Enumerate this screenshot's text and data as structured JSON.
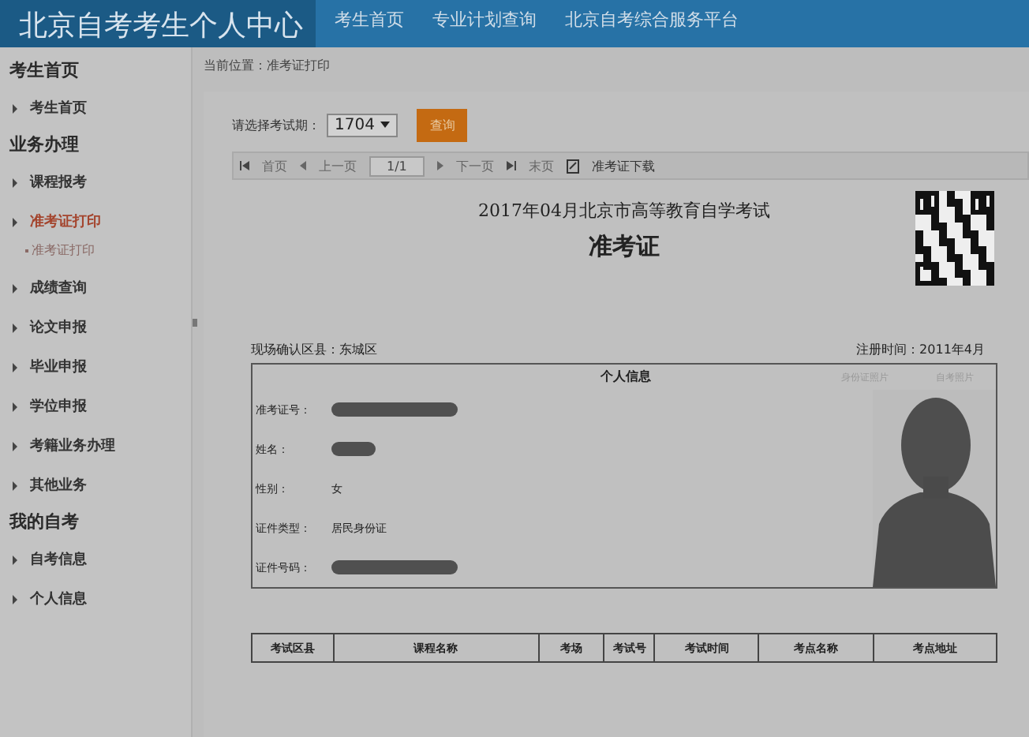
{
  "header": {
    "title": "北京自考考生个人中心",
    "nav": [
      "考生首页",
      "专业计划查询",
      "北京自考综合服务平台"
    ]
  },
  "sidebar": [
    {
      "kind": "heading",
      "label": "考生首页"
    },
    {
      "kind": "item",
      "label": "考生首页",
      "selected": false
    },
    {
      "kind": "heading",
      "label": "业务办理"
    },
    {
      "kind": "item",
      "label": "课程报考",
      "selected": false
    },
    {
      "kind": "item",
      "label": "准考证打印",
      "selected": true,
      "children": [
        {
          "label": "准考证打印"
        }
      ]
    },
    {
      "kind": "item",
      "label": "成绩查询",
      "selected": false
    },
    {
      "kind": "item",
      "label": "论文申报",
      "selected": false
    },
    {
      "kind": "item",
      "label": "毕业申报",
      "selected": false
    },
    {
      "kind": "item",
      "label": "学位申报",
      "selected": false
    },
    {
      "kind": "item",
      "label": "考籍业务办理",
      "selected": false
    },
    {
      "kind": "item",
      "label": "其他业务",
      "selected": false
    },
    {
      "kind": "heading",
      "label": "我的自考"
    },
    {
      "kind": "item",
      "label": "自考信息",
      "selected": false
    },
    {
      "kind": "item",
      "label": "个人信息",
      "selected": false
    }
  ],
  "breadcrumb": "当前位置：准考证打印",
  "query": {
    "label": "请选择考试期：",
    "value": "1704",
    "button": "查询"
  },
  "pager": {
    "first": "首页",
    "prev": "上一页",
    "page": "1/1",
    "next": "下一页",
    "last": "末页",
    "download": "准考证下载"
  },
  "document": {
    "title": "2017年04月北京市高等教育自学考试",
    "subtitle": "准考证",
    "district": "现场确认区县：东城区",
    "registered": "注册时间：2011年4月",
    "info_title": "个人信息",
    "photo_labels": [
      "身份证照片",
      "自考照片"
    ],
    "fields": [
      {
        "label": "准考证号：",
        "kind": "redacted"
      },
      {
        "label": "姓名：",
        "kind": "redacted_short"
      },
      {
        "label": "性别：",
        "kind": "text",
        "value": "女"
      },
      {
        "label": "证件类型：",
        "kind": "text",
        "value": "居民身份证"
      },
      {
        "label": "证件号码：",
        "kind": "redacted"
      }
    ],
    "exam_columns": [
      "考试区县",
      "课程名称",
      "考场",
      "考试号",
      "考试时间",
      "考点名称",
      "考点地址"
    ]
  }
}
